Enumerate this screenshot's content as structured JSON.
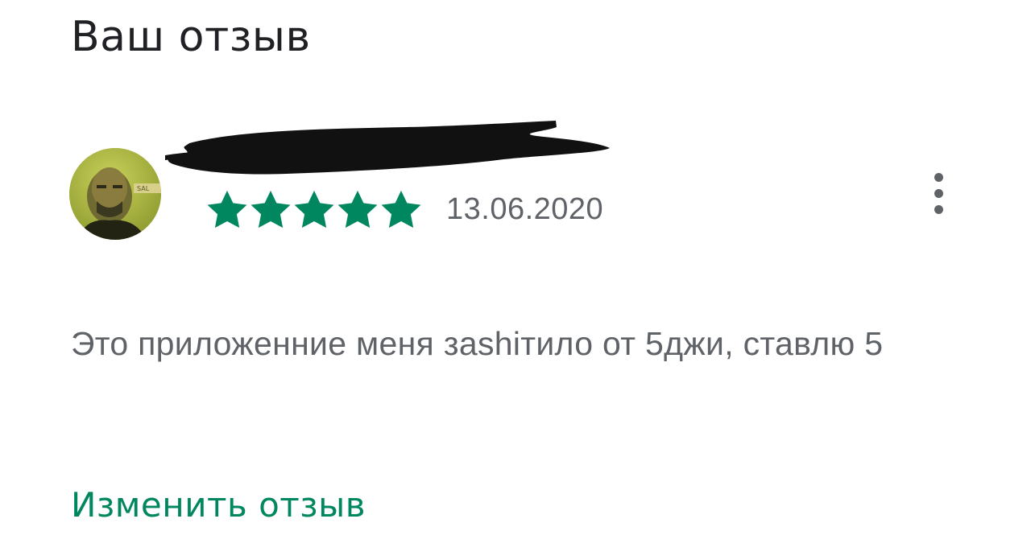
{
  "section": {
    "title": "Ваш отзыв"
  },
  "review": {
    "author_name": "",
    "author_name_redacted": true,
    "rating": 5,
    "rating_max": 5,
    "date": "13.06.2020",
    "text": "Это приложенние меня заshiтило от 5джи, ставлю 5",
    "avatar_icon": "user-photo-avatar",
    "menu_icon": "more-vert-icon"
  },
  "actions": {
    "edit_label": "Изменить отзыв"
  },
  "colors": {
    "title": "#202124",
    "secondary_text": "#5f6368",
    "star": "#01875f",
    "accent": "#01875f",
    "redaction": "#111111"
  }
}
